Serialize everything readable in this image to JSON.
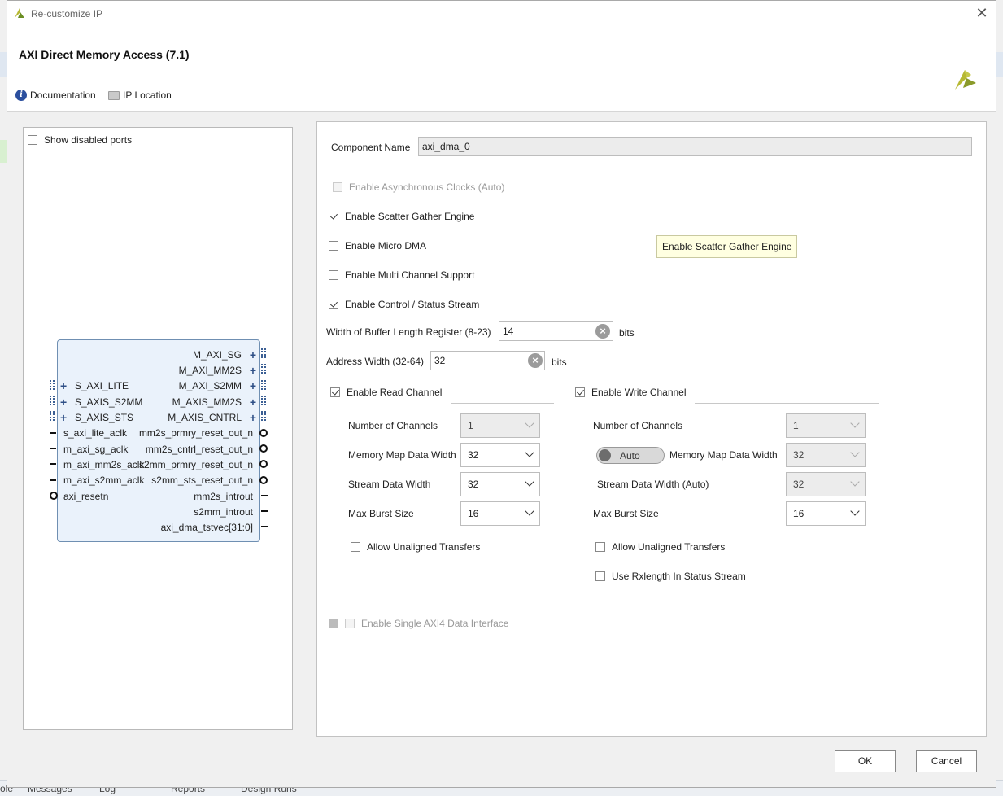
{
  "dialog": {
    "title": "Re-customize IP",
    "ip_title": "AXI Direct Memory Access (7.1)",
    "documentation_label": "Documentation",
    "ip_location_label": "IP Location"
  },
  "left_panel": {
    "show_disabled_ports_label": "Show disabled ports",
    "show_disabled_ports_checked": false,
    "block": {
      "left_bus_ports": [
        "S_AXI_LITE",
        "S_AXIS_S2MM",
        "S_AXIS_STS"
      ],
      "left_signal_ports": [
        "s_axi_lite_aclk",
        "m_axi_sg_aclk",
        "m_axi_mm2s_aclk",
        "m_axi_s2mm_aclk",
        "axi_resetn"
      ],
      "right_bus_ports": [
        "M_AXI_SG",
        "M_AXI_MM2S",
        "M_AXI_S2MM",
        "M_AXIS_MM2S",
        "M_AXIS_CNTRL"
      ],
      "right_signal_ports": [
        "mm2s_prmry_reset_out_n",
        "mm2s_cntrl_reset_out_n",
        "s2mm_prmry_reset_out_n",
        "s2mm_sts_reset_out_n",
        "mm2s_introut",
        "s2mm_introut",
        "axi_dma_tstvec[31:0]"
      ]
    }
  },
  "config": {
    "component_name_label": "Component Name",
    "component_name_value": "axi_dma_0",
    "enable_async_clocks_label": "Enable Asynchronous Clocks (Auto)",
    "enable_scatter_gather_label": "Enable Scatter Gather Engine",
    "enable_scatter_gather_checked": true,
    "enable_micro_dma_label": "Enable Micro DMA",
    "enable_multi_channel_label": "Enable Multi Channel Support",
    "enable_control_status_label": "Enable Control / Status Stream",
    "enable_control_status_checked": true,
    "buffer_length_label": "Width of Buffer Length Register (8-23)",
    "buffer_length_value": "14",
    "buffer_length_unit": "bits",
    "address_width_label": "Address Width (32-64)",
    "address_width_value": "32",
    "address_width_unit": "bits",
    "tooltip": "Enable Scatter Gather Engine",
    "single_axi4_label": "Enable Single AXI4 Data Interface"
  },
  "read_channel": {
    "label": "Enable Read Channel",
    "checked": true,
    "num_channels_label": "Number of Channels",
    "num_channels_value": "1",
    "mm_data_width_label": "Memory Map Data Width",
    "mm_data_width_value": "32",
    "stream_data_width_label": "Stream Data Width",
    "stream_data_width_value": "32",
    "max_burst_label": "Max Burst Size",
    "max_burst_value": "16",
    "unaligned_label": "Allow Unaligned Transfers"
  },
  "write_channel": {
    "label": "Enable Write Channel",
    "checked": true,
    "num_channels_label": "Number of Channels",
    "num_channels_value": "1",
    "auto_toggle_label": "Auto",
    "mm_data_width_label": "Memory Map Data Width",
    "mm_data_width_value": "32",
    "stream_data_width_label": "Stream Data Width (Auto)",
    "stream_data_width_value": "32",
    "max_burst_label": "Max Burst Size",
    "max_burst_value": "16",
    "unaligned_label": "Allow Unaligned Transfers",
    "rxlength_label": "Use Rxlength In Status Stream"
  },
  "buttons": {
    "ok": "OK",
    "cancel": "Cancel"
  },
  "background": {
    "tabs": [
      "ole",
      "Messages",
      "Log",
      "Reports",
      "Design Runs"
    ]
  },
  "colors": {
    "block_fill": "#eaf2fb",
    "block_border": "#6f8fb2",
    "tooltip_bg": "#ffffe1",
    "accent": "#2b4f9e"
  }
}
